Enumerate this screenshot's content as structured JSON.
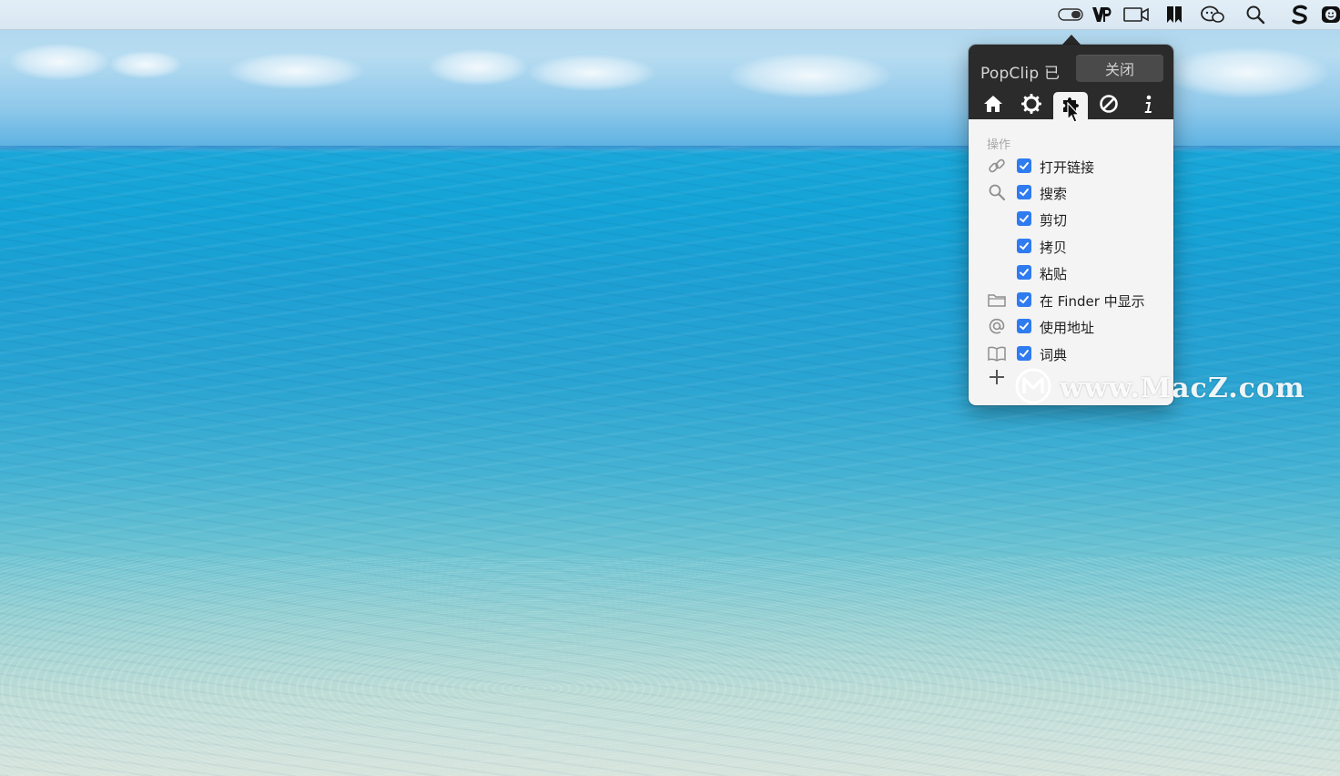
{
  "desktop": {
    "wallpaper": "ocean-beach"
  },
  "menubar": {
    "icons": [
      {
        "name": "toggle-icon"
      },
      {
        "name": "vp-app-icon"
      },
      {
        "name": "video-camera-icon"
      },
      {
        "name": "bookmark-app-icon"
      },
      {
        "name": "chat-bubbles-icon"
      },
      {
        "name": "spotlight-search-icon"
      },
      {
        "name": "s-app-icon"
      },
      {
        "name": "smiley-app-icon"
      }
    ]
  },
  "popclip": {
    "title": "PopClip 已",
    "close_label": "关闭",
    "tabs": [
      {
        "name": "home-icon",
        "selected": false
      },
      {
        "name": "gear-icon",
        "selected": false
      },
      {
        "name": "puzzle-icon",
        "selected": true
      },
      {
        "name": "prohibited-icon",
        "selected": false
      },
      {
        "name": "info-icon",
        "selected": false
      }
    ],
    "section_label": "操作",
    "actions": [
      {
        "label": "打开链接",
        "icon": "link-icon",
        "checked": true
      },
      {
        "label": "搜索",
        "icon": "search-icon",
        "checked": true
      },
      {
        "label": "剪切",
        "icon": "",
        "checked": true
      },
      {
        "label": "拷贝",
        "icon": "",
        "checked": true
      },
      {
        "label": "粘贴",
        "icon": "",
        "checked": true
      },
      {
        "label": "在 Finder 中显示",
        "icon": "folder-icon",
        "checked": true
      },
      {
        "label": "使用地址",
        "icon": "at-icon",
        "checked": true
      },
      {
        "label": "词典",
        "icon": "book-icon",
        "checked": true
      }
    ],
    "add_icon": "plus-icon",
    "checkbox_color": "#2f7bf0"
  },
  "watermark": {
    "text": "www.MacZ.com"
  }
}
